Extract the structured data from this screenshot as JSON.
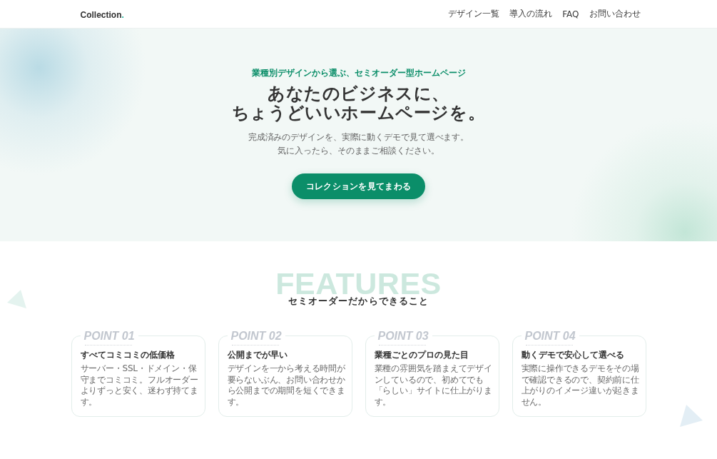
{
  "header": {
    "logo": "Collection",
    "logo_mark": ".",
    "nav": [
      "デザイン一覧",
      "導入の流れ",
      "FAQ",
      "お問い合わせ"
    ]
  },
  "hero": {
    "tagline": "業種別デザインから選ぶ、セミオーダー型ホームページ",
    "heading": [
      "あなたのビジネスに、",
      "ちょうどいいホームページを。"
    ],
    "lead": [
      "完成済みのデザインを、実際に動くデモで見て選べます。",
      "気に入ったら、そのままご相談ください。"
    ],
    "cta": "コレクションを見てまわる"
  },
  "features": {
    "watermark": "FEATURES",
    "heading": "セミオーダーだからできること",
    "points": [
      {
        "label": "POINT 01",
        "title": "すべてコミコミの低価格",
        "text": "サーバー・SSL・ドメイン・保守までコミコミ。フルオーダーよりずっと安く、迷わず持てます。"
      },
      {
        "label": "POINT 02",
        "title": "公開までが早い",
        "text": "デザインを一から考える時間が要らないぶん、お問い合わせから公開までの期間を短くできます。"
      },
      {
        "label": "POINT 03",
        "title": "業種ごとのプロの見た目",
        "text": "業種の雰囲気を踏まえてデザインしているので、初めてでも「らしい」サイトに仕上がります。"
      },
      {
        "label": "POINT 04",
        "title": "動くデモで安心して選べる",
        "text": "実際に操作できるデモをその場で確認できるので、契約前に仕上がりのイメージ違いが起きません。"
      }
    ]
  }
}
